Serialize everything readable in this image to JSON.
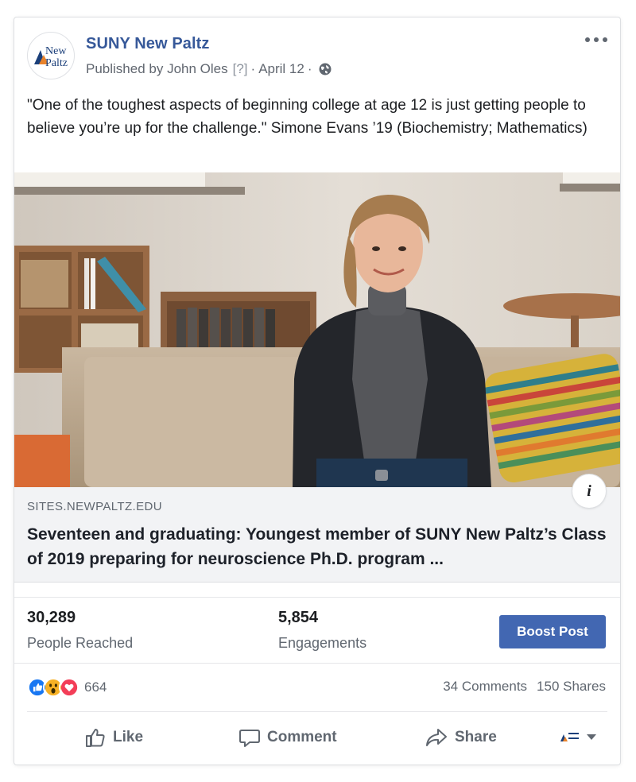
{
  "post": {
    "page_name": "SUNY New Paltz",
    "avatar_text_line1": "New",
    "avatar_text_line2": "Paltz",
    "published_by": "Published by John Oles",
    "help_marker": "[?]",
    "separator": "·",
    "date": "April 12",
    "text": "\"One of the toughest aspects of beginning college at age 12 is just getting people to believe you’re up for the challenge.\" Simone Evans ’19 (Biochemistry; Mathematics)"
  },
  "link_preview": {
    "domain": "SITES.NEWPALTZ.EDU",
    "title": "Seventeen and graduating: Youngest member of SUNY New Paltz’s Class of 2019 preparing for neuroscience Ph.D. program ...",
    "info_icon_glyph": "i"
  },
  "stats": {
    "reached_value": "30,289",
    "reached_label": "People Reached",
    "engagements_value": "5,854",
    "engagements_label": "Engagements",
    "boost_label": "Boost Post"
  },
  "reactions": {
    "icons": [
      "like-icon",
      "wow-icon",
      "love-icon"
    ],
    "count": "664",
    "comments": "34 Comments",
    "shares": "150 Shares"
  },
  "actions": {
    "like": "Like",
    "comment": "Comment",
    "share": "Share"
  },
  "colors": {
    "page_link": "#365899",
    "boost": "#4267b2",
    "link_box_bg": "#f2f3f5",
    "like": "#1877f2",
    "love": "#f33e58",
    "wow": "#f7b125"
  }
}
